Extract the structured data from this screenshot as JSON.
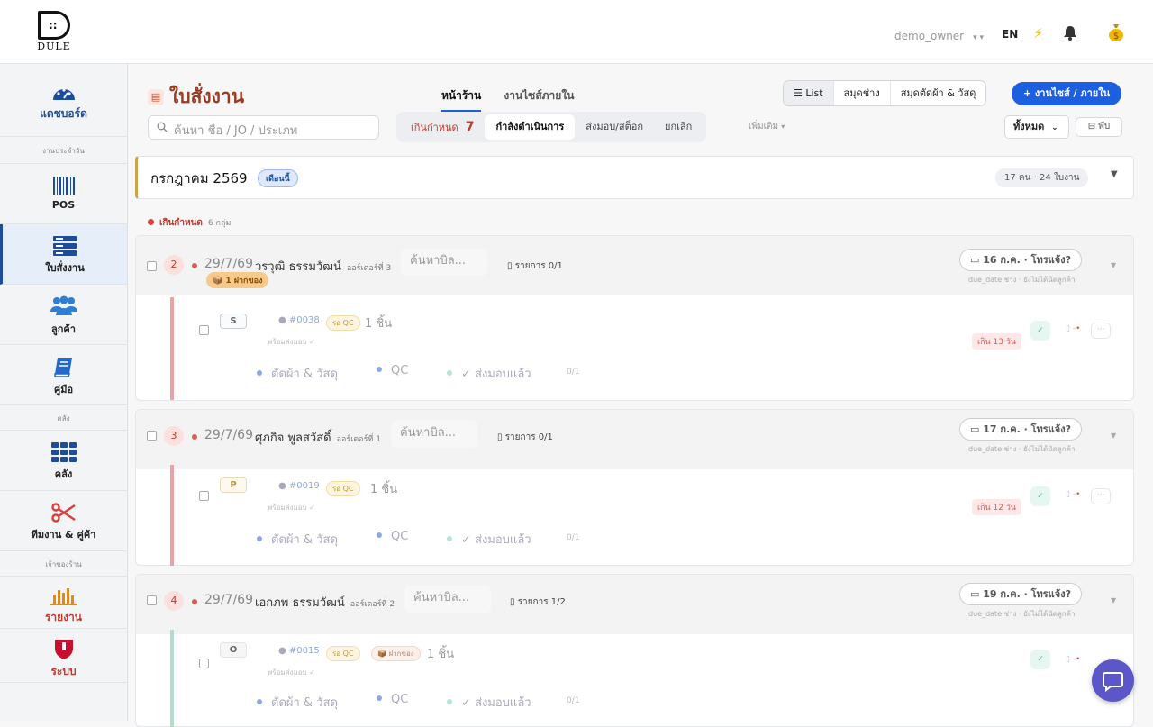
{
  "brand": {
    "logo_text": "DULE",
    "logo_mark": "::"
  },
  "topbar": {
    "username": "demo_owner",
    "lang": "EN"
  },
  "sidebar": {
    "items": [
      {
        "label": "แดชบอร์ด",
        "icon": "dashboard-gauge-icon"
      },
      {
        "label": "POS",
        "icon": "barcode-icon"
      },
      {
        "label": "ใบสั่งงาน",
        "icon": "server-stack-icon"
      },
      {
        "label": "ลูกค้า",
        "icon": "users-icon"
      },
      {
        "label": "คู่มือ",
        "icon": "book-icon"
      },
      {
        "label": "คลัง",
        "icon": "grid-icon"
      },
      {
        "label": "ทีมงาน & คู่ค้า",
        "icon": "scissors-icon"
      },
      {
        "label": "รายงาน",
        "icon": "bar-chart-icon"
      },
      {
        "label": "ระบบ",
        "icon": "shield-icon"
      }
    ],
    "sections": [
      "งานประจำวัน",
      "คลัง",
      "เจ้าของร้าน"
    ]
  },
  "page": {
    "title": "ใบสั่งงาน",
    "tabs": [
      "หน้าร้าน",
      "งานไซส์ภายใน"
    ],
    "view_switch": [
      "List",
      "สมุดช่าง",
      "สมุดตัดผ้า & วัสดุ"
    ],
    "new_button": "+ งานไซส์ / ภายใน",
    "search_placeholder": "ค้นหา ชื่อ / JO / ประเภท",
    "filters": {
      "overdue_label": "เกินกำหนด",
      "overdue_count": "7",
      "in_progress": "กำลังดำเนินการ",
      "delivered": "ส่งมอบ/สต็อก",
      "cancelled": "ยกเลิก"
    },
    "more": "เพิ่มเติม",
    "scope": "ทั้งหมด",
    "fold": "⊟ พับ"
  },
  "month_group": {
    "title": "กรกฎาคม 2569",
    "badge": "เดือนนี้",
    "count": "17 คน · 24 ใบงาน"
  },
  "overdue_group": {
    "label": "เกินกำหนด",
    "count": "6 กลุ่ม"
  },
  "stage_labels": {
    "cut": "ตัดผ้า & วัสดุ",
    "qc": "QC",
    "done": "✓ ส่งมอบแล้ว"
  },
  "cards": [
    {
      "num": "2",
      "date": "29/7/69",
      "name": "วรวุฒิ ธรรมวัฒน์",
      "order": "ออร์เดอร์ที่ 3",
      "search": "ค้นหาบิล...",
      "items": "รายการ 0/1",
      "due": "16 ก.ค. · โทรแจ้ง?",
      "due_hint": "due_date ช่าง · ยังไม่ได้นัดลูกค้า",
      "tag": "📦 1 ฝากของ",
      "job": {
        "letter": "S",
        "jo": "#0038",
        "qc": "รอ QC",
        "qty": "1 ชิ้น",
        "ready": "พร้อมส่งมอบ ✓",
        "stage_count": "0/1",
        "late": "เกิน 13 วัน"
      }
    },
    {
      "num": "3",
      "date": "29/7/69",
      "name": "ศุภกิจ พูลสวัสดิ์",
      "order": "ออร์เดอร์ที่ 1",
      "search": "ค้นหาบิล...",
      "items": "รายการ 0/1",
      "due": "17 ก.ค. · โทรแจ้ง?",
      "due_hint": "due_date ช่าง · ยังไม่ได้นัดลูกค้า",
      "tag": "",
      "job": {
        "letter": "P",
        "jo": "#0019",
        "qc": "รอ QC",
        "qty": "1 ชิ้น",
        "ready": "พร้อมส่งมอบ ✓",
        "stage_count": "0/1",
        "late": "เกิน 12 วัน"
      }
    },
    {
      "num": "4",
      "date": "29/7/69",
      "name": "เอกภพ ธรรมวัฒน์",
      "order": "ออร์เดอร์ที่ 2",
      "search": "ค้นหาบิล...",
      "items": "รายการ 1/2",
      "due": "19 ก.ค. · โทรแจ้ง?",
      "due_hint": "due_date ช่าง · ยังไม่ได้นัดลูกค้า",
      "tag": "",
      "job": {
        "letter": "O",
        "jo": "#0015",
        "qc": "รอ QC",
        "deposit": "📦 ฝากของ",
        "qty": "1 ชิ้น",
        "ready": "พร้อมส่งมอบ ✓",
        "stage_count": "0/1",
        "late": ""
      }
    }
  ],
  "colors": {
    "accent": "#1c5fe0",
    "title": "#9a3a1e",
    "danger": "#c0392b",
    "chat": "#5b57c9"
  }
}
